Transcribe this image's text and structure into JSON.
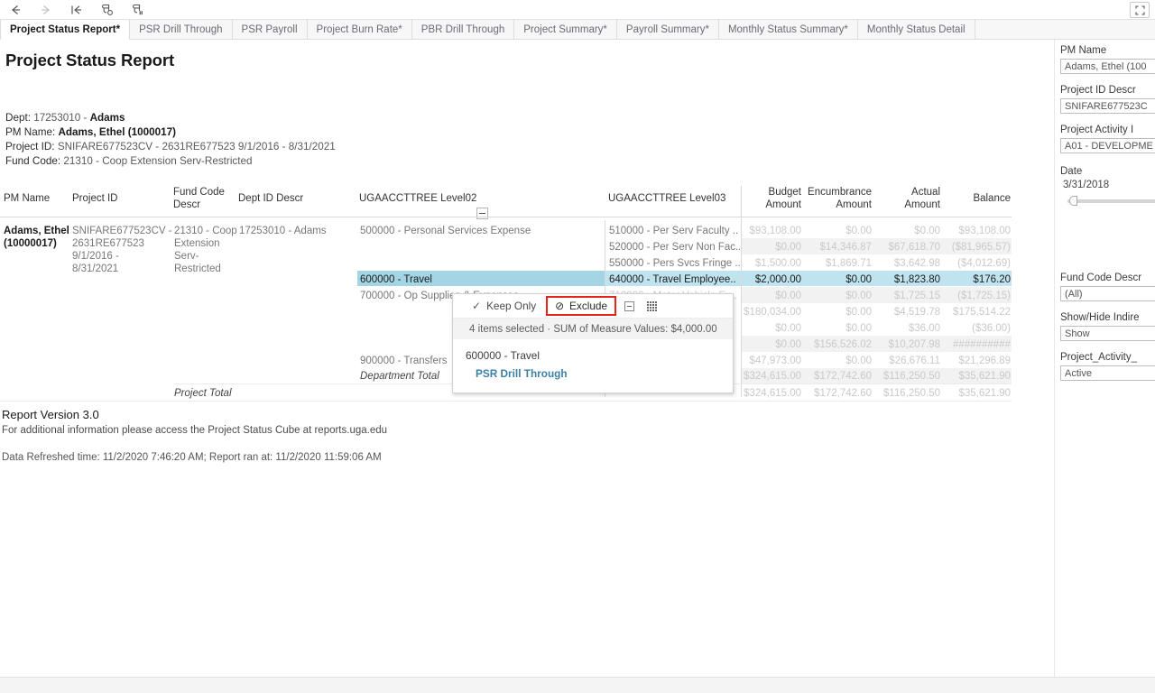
{
  "toolbar": {
    "icons": [
      {
        "name": "back-arrow-icon",
        "glyph": "←"
      },
      {
        "name": "forward-arrow-icon",
        "glyph": "→"
      },
      {
        "name": "revert-all-icon",
        "glyph": "|←"
      },
      {
        "name": "refresh-data-icon",
        "glyph": "refresh"
      },
      {
        "name": "pause-auto-updates-icon",
        "glyph": "pause"
      }
    ],
    "fullscreen_label": "presentation-mode"
  },
  "tabs": [
    {
      "label": "Project Status Report*",
      "active": true
    },
    {
      "label": "PSR Drill Through",
      "active": false
    },
    {
      "label": "PSR Payroll",
      "active": false
    },
    {
      "label": "Project Burn Rate*",
      "active": false
    },
    {
      "label": "PBR Drill Through",
      "active": false
    },
    {
      "label": "Project Summary*",
      "active": false
    },
    {
      "label": "Payroll Summary*",
      "active": false
    },
    {
      "label": "Monthly Status Summary*",
      "active": false
    },
    {
      "label": "Monthly Status Detail",
      "active": false
    }
  ],
  "report": {
    "title": "Project Status Report",
    "dept_label": "Dept:",
    "dept_code": "17253010 -",
    "dept_name": "Adams",
    "pm_label": "PM Name:",
    "pm_value": "Adams, Ethel (1000017)",
    "project_label": "Project ID:",
    "project_value": "SNIFARE677523CV - 2631RE677523 9/1/2016 - 8/31/2021",
    "fund_label": "Fund Code:",
    "fund_value": "21310 - Coop Extension Serv-Restricted"
  },
  "table": {
    "headers": {
      "pm_name": "PM Name",
      "project_id": "Project ID",
      "fund_code_descr": "Fund Code\nDescr",
      "fund_code_descr_l1": "Fund Code",
      "fund_code_descr_l2": "Descr",
      "dept_id_descr": "Dept ID Descr",
      "level02": "UGAACCTTREE Level02",
      "level03": "UGAACCTTREE Level03",
      "budget_l1": "Budget",
      "budget_l2": "Amount",
      "encumbrance_l1": "Encumbrance",
      "encumbrance_l2": "Amount",
      "actual_l1": "Actual",
      "actual_l2": "Amount",
      "balance": "Balance"
    },
    "dim": {
      "pm_name": "Adams, Ethel (10000017)",
      "pm_name_l1": "Adams, Ethel",
      "pm_name_l2": "(10000017)",
      "project_id_lines": [
        "SNIFARE677523CV -",
        "2631RE677523",
        "9/1/2016 -",
        "8/31/2021"
      ],
      "fund_code_lines": [
        "21310 - Coop",
        "Extension",
        "Serv-",
        "Restricted"
      ],
      "dept_id_descr": "17253010 - Adams"
    },
    "rows": [
      {
        "level02": "500000 - Personal Services Expense",
        "level03": "510000 - Per Serv Faculty ..",
        "budget": "$93,108.00",
        "encumbrance": "$0.00",
        "actual": "$0.00",
        "balance": "$93,108.00",
        "selected": false,
        "band": false
      },
      {
        "level02": "",
        "level03": "520000 - Per Serv Non Fac..",
        "budget": "$0.00",
        "encumbrance": "$14,346.87",
        "actual": "$67,618.70",
        "balance": "($81,965.57)",
        "selected": false,
        "band": true
      },
      {
        "level02": "",
        "level03": "550000 - Pers Svcs Fringe ..",
        "budget": "$1,500.00",
        "encumbrance": "$1,869.71",
        "actual": "$3,642.98",
        "balance": "($4,012.69)",
        "selected": false,
        "band": false
      },
      {
        "level02": "600000 - Travel",
        "level03": "640000 - Travel Employee..",
        "budget": "$2,000.00",
        "encumbrance": "$0.00",
        "actual": "$1,823.80",
        "balance": "$176.20",
        "selected": true,
        "band": false
      },
      {
        "level02": "700000 - Op Supplies & Expenses",
        "level03": "712000 - Motor Vehicle Ex..",
        "budget": "$0.00",
        "encumbrance": "$0.00",
        "actual": "$1,725.15",
        "balance": "($1,725.15)",
        "selected": false,
        "band": true
      },
      {
        "level02": "",
        "level03": "",
        "budget": "$180,034.00",
        "encumbrance": "$0.00",
        "actual": "$4,519.78",
        "balance": "$175,514.22",
        "selected": false,
        "band": false
      },
      {
        "level02": "",
        "level03": "",
        "budget": "$0.00",
        "encumbrance": "$0.00",
        "actual": "$36.00",
        "balance": "($36.00)",
        "selected": false,
        "band": false
      },
      {
        "level02": "",
        "level03": "",
        "budget": "$0.00",
        "encumbrance": "$156,526.02",
        "actual": "$10,207.98",
        "balance": "##########",
        "selected": false,
        "band": true
      },
      {
        "level02": "900000 - Transfers",
        "level03": "",
        "budget": "$47,973.00",
        "encumbrance": "$0.00",
        "actual": "$26,676.11",
        "balance": "$21,296.89",
        "selected": false,
        "band": false
      },
      {
        "level02": "Department Total",
        "level03": "",
        "budget": "$324,615.00",
        "encumbrance": "$172,742.60",
        "actual": "$116,250.50",
        "balance": "$35,621.90",
        "selected": false,
        "band": true
      },
      {
        "level02": "Project Total",
        "level03": "",
        "budget": "$324,615.00",
        "encumbrance": "$172,742.60",
        "actual": "$116,250.50",
        "balance": "$35,621.90",
        "selected": false,
        "band": false
      }
    ]
  },
  "tooltip": {
    "keep_only": "Keep Only",
    "exclude": "Exclude",
    "keep_only_glyph": "✓",
    "exclude_glyph": "⊘",
    "group_members_name": "group-members-icon",
    "view_data_name": "view-data-icon",
    "summary": "4 items selected  ·  SUM of Measure Values: $4,000.00",
    "member": "600000 - Travel",
    "link": "PSR Drill Through",
    "highlight_color": "#e8231a"
  },
  "footer": {
    "version": "Report Version 3.0",
    "info": "For additional information please access the Project Status Cube at reports.uga.edu",
    "refreshed": "Data Refreshed time: 11/2/2020 7:46:20 AM; Report ran at: 11/2/2020 11:59:06 AM"
  },
  "filters": [
    {
      "label": "PM Name",
      "value": "Adams, Ethel (100",
      "type": "dropdown"
    },
    {
      "label": "Project ID Descr",
      "value": "SNIFARE677523C",
      "type": "dropdown"
    },
    {
      "label": "Project Activity I",
      "value": "A01 - DEVELOPME",
      "type": "dropdown"
    },
    {
      "label": "Date",
      "value": "3/31/2018",
      "type": "slider"
    },
    {
      "label": "Fund Code Descr",
      "value": "(All)",
      "type": "dropdown"
    },
    {
      "label": "Show/Hide Indire",
      "value": "Show",
      "type": "dropdown"
    },
    {
      "label": "Project_Activity_",
      "value": "Active",
      "type": "dropdown"
    }
  ]
}
